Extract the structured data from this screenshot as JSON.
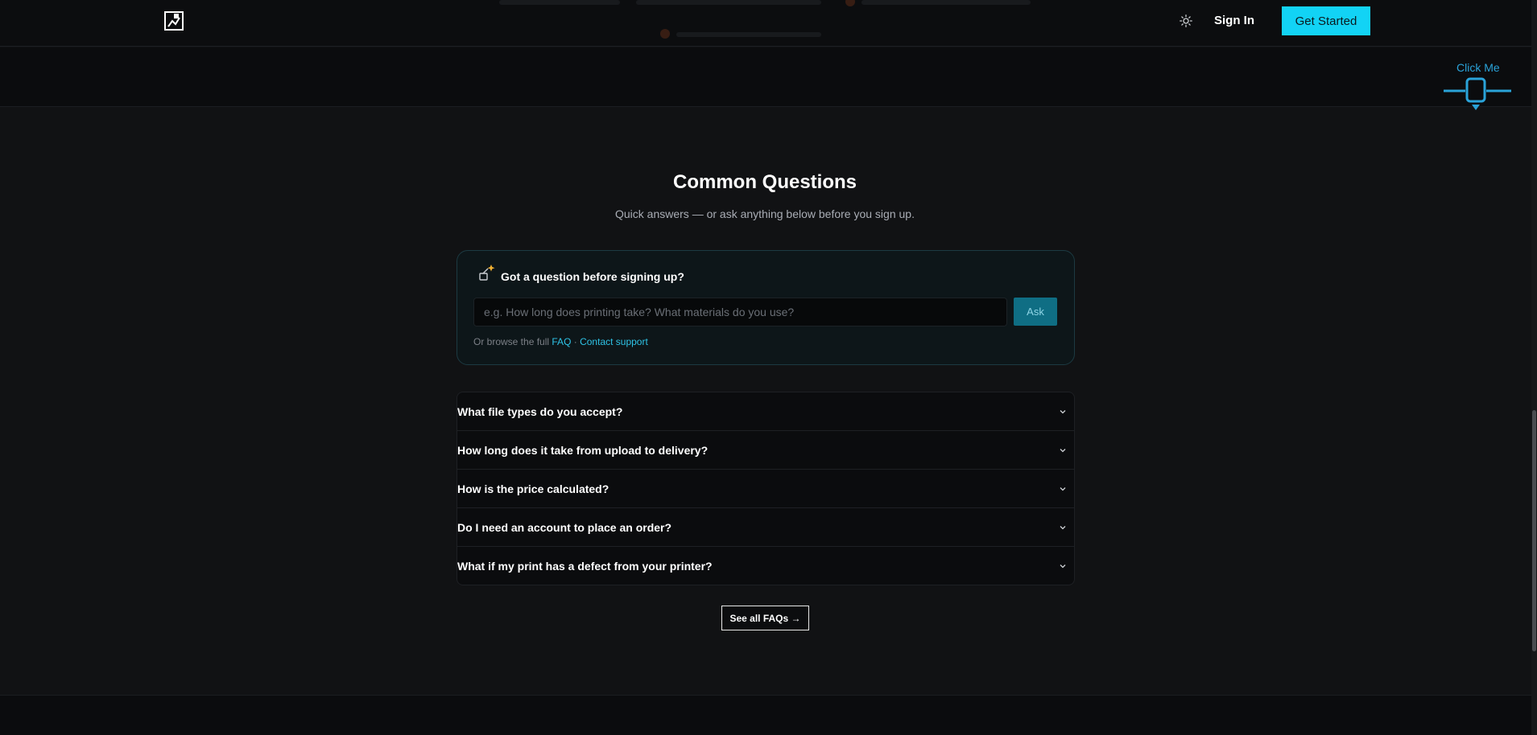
{
  "header": {
    "logo_icon": "logo-icon",
    "theme_icon": "sun-icon",
    "signin_label": "Sign In",
    "cta_label": "Get Started",
    "accent_color": "#12d3f5"
  },
  "widget": {
    "label": "Click Me",
    "color": "#2aa3d9"
  },
  "main": {
    "title": "Common Questions",
    "subtitle": "Quick answers — or ask anything below before you sign up.",
    "ask": {
      "emoji_icon": "sparkle-emoji-icon",
      "title": "Got a question before signing up?",
      "placeholder": "e.g. How long does printing take? What materials do you use?",
      "button_label": "Ask",
      "footer_prefix": "Or browse the full",
      "faq_link": "FAQ",
      "separator": "·",
      "support_link": "Contact support"
    },
    "faqs": [
      {
        "question": "What file types do you accept?"
      },
      {
        "question": "How long does it take from upload to delivery?"
      },
      {
        "question": "How is the price calculated?"
      },
      {
        "question": "Do I need an account to place an order?"
      },
      {
        "question": "What if my print has a defect from your printer?"
      }
    ],
    "see_all_label": "See all FAQs →"
  }
}
